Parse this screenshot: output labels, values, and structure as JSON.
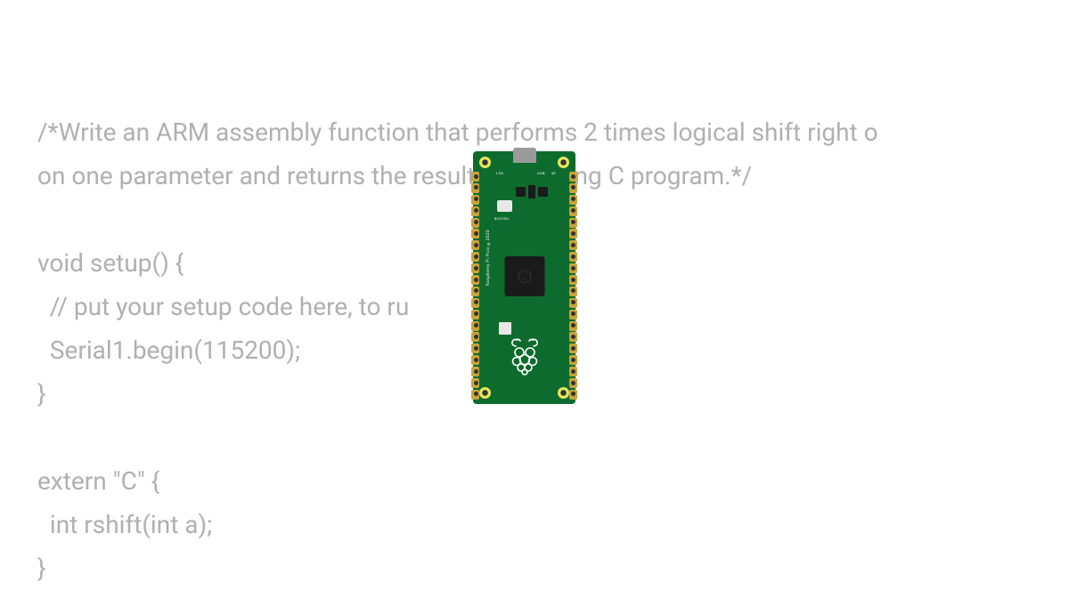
{
  "code": {
    "line1": "/*Write an ARM assembly function that performs 2 times logical shift right o",
    "line2": "on one parameter and returns the result to a calling C program.*/",
    "line3": "",
    "line4": "void setup() {",
    "line5": "  // put your setup code here, to ru",
    "line6": "  Serial1.begin(115200);",
    "line7": "}",
    "line8": "",
    "line9": "extern \"C\" {",
    "line10": "  int rshift(int a);",
    "line11": "}"
  },
  "board": {
    "led_label": "LED",
    "usb_label": "USB",
    "bootsel_label": "BOOTSEL",
    "side_text": "Raspberry Pi Pico ©2020",
    "pin_marker": "35"
  }
}
